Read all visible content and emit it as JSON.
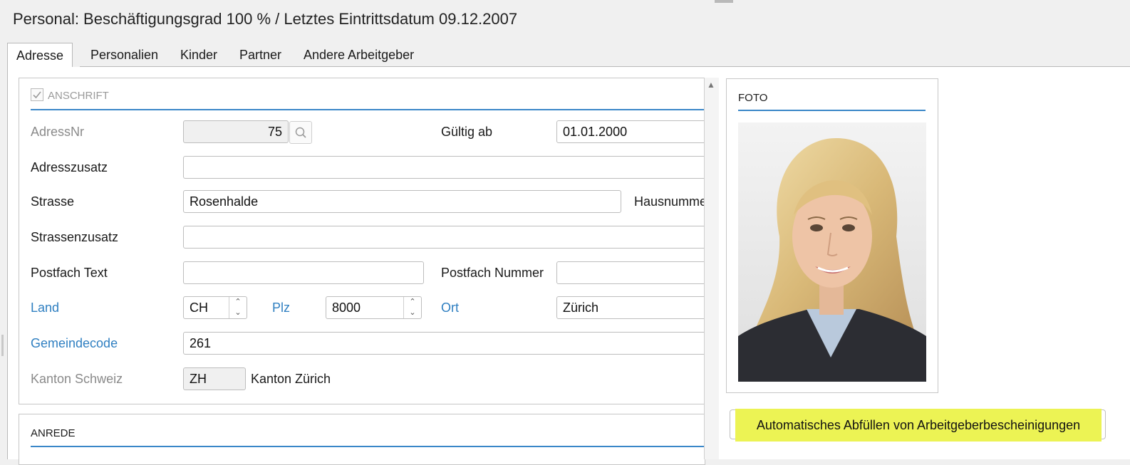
{
  "page": {
    "title": "Personal: Beschäftigungsgrad 100 % / Letztes Eintrittsdatum 09.12.2007"
  },
  "tabs": [
    "Adresse",
    "Personalien",
    "Kinder",
    "Partner",
    "Andere Arbeitgeber"
  ],
  "active_tab": "Adresse",
  "anschrift": {
    "header": "ANSCHRIFT",
    "checked": true,
    "adressnr_label": "AdressNr",
    "adressnr_value": "75",
    "gueltig_ab_label": "Gültig ab",
    "gueltig_ab_value": "01.01.2000",
    "adresszusatz_label": "Adresszusatz",
    "adresszusatz_value": "",
    "strasse_label": "Strasse",
    "strasse_value": "Rosenhalde",
    "hausnummer_label": "Hausnumme",
    "strassenzusatz_label": "Strassenzusatz",
    "strassenzusatz_value": "",
    "postfach_text_label": "Postfach Text",
    "postfach_text_value": "",
    "postfach_nummer_label": "Postfach Nummer",
    "postfach_nummer_value": "",
    "land_label": "Land",
    "land_value": "CH",
    "plz_label": "Plz",
    "plz_value": "8000",
    "ort_label": "Ort",
    "ort_value": "Zürich",
    "gemeindecode_label": "Gemeindecode",
    "gemeindecode_value": "261",
    "kanton_label": "Kanton Schweiz",
    "kanton_value": "ZH",
    "kanton_name": "Kanton Zürich"
  },
  "anrede": {
    "header": "ANREDE"
  },
  "foto": {
    "header": "FOTO"
  },
  "actions": {
    "auto_fill_label": "Automatisches Abfüllen von Arbeitgeberbescheinigungen"
  },
  "colors": {
    "accent": "#3a87c8",
    "link_label": "#2f7fc1",
    "highlight": "#ecf354"
  }
}
